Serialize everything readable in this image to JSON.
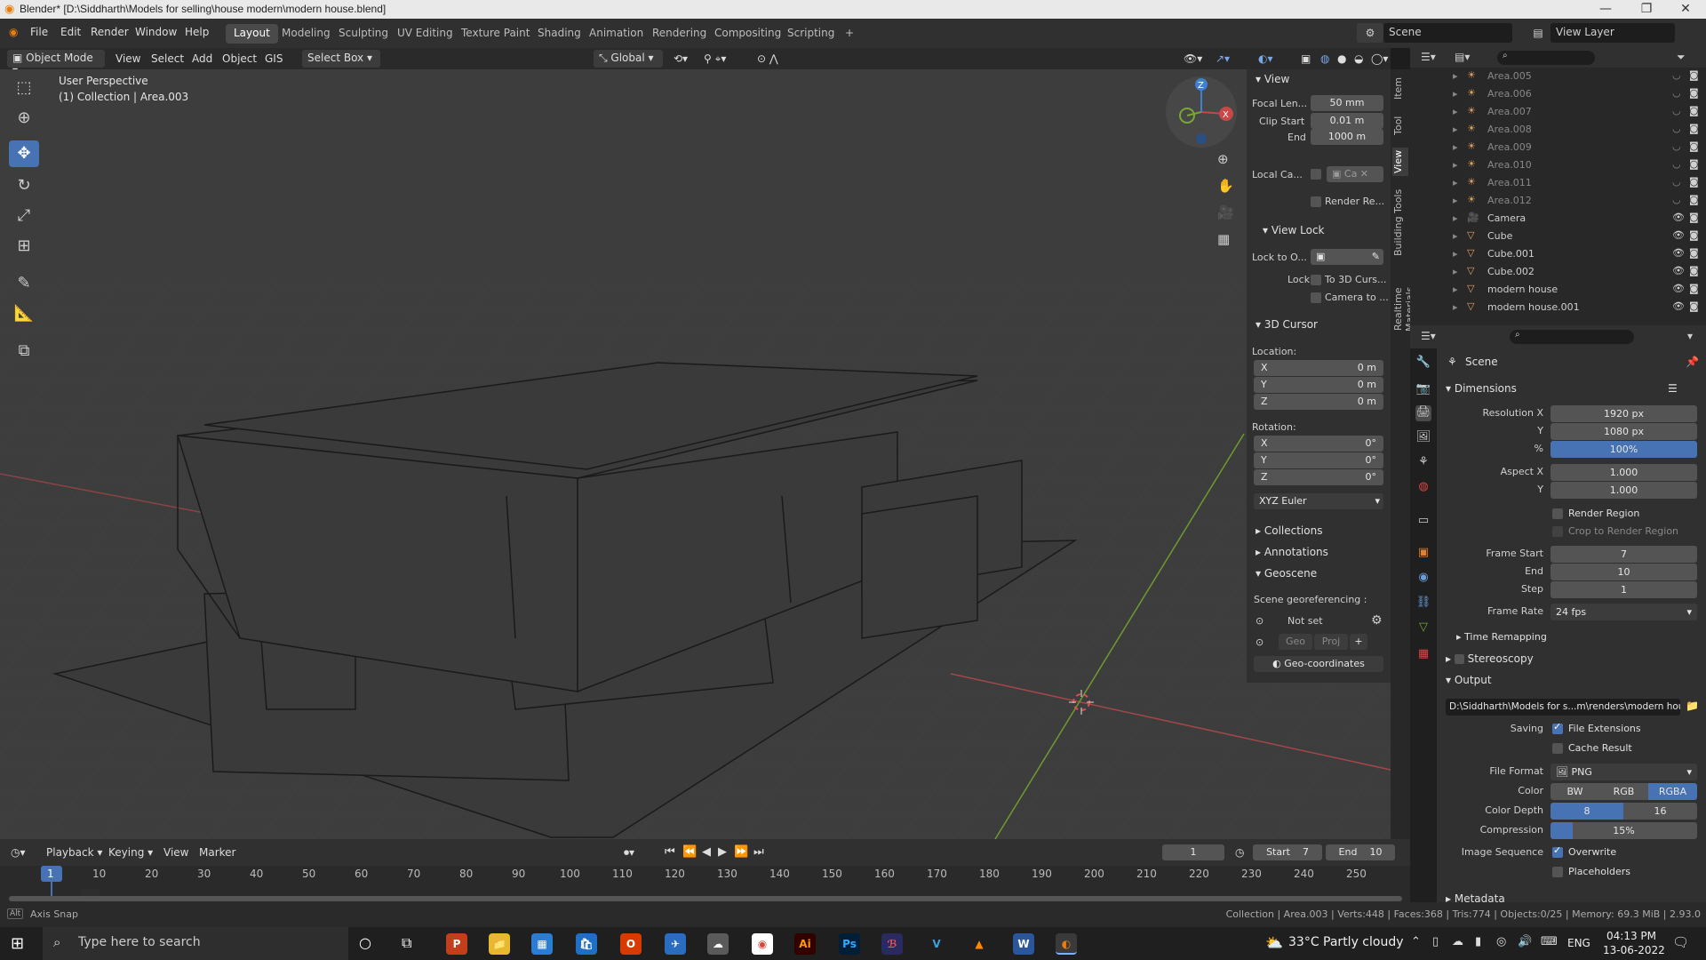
{
  "titlebar": {
    "title": "Blender* [D:\\Siddharth\\Models for selling\\house modern\\modern house.blend]",
    "minimize": "—",
    "maximize": "❐",
    "close": "✕"
  },
  "menu": {
    "items": [
      "File",
      "Edit",
      "Render",
      "Window",
      "Help"
    ],
    "workspaces": [
      "Layout",
      "Modeling",
      "Sculpting",
      "UV Editing",
      "Texture Paint",
      "Shading",
      "Animation",
      "Rendering",
      "Compositing",
      "Scripting"
    ],
    "active_workspace": "Layout",
    "add_workspace": "+",
    "scene": "Scene",
    "view_layer": "View Layer"
  },
  "viewport_header": {
    "mode": "Object Mode",
    "view": "View",
    "select": "Select",
    "add": "Add",
    "object": "Object",
    "gis": "GIS",
    "select_box": "Select Box",
    "orientation": "Global"
  },
  "viewport": {
    "perspective": "User Perspective",
    "collection": "(1) Collection | Area.003",
    "gizmo": {
      "x": "X",
      "y": "Y",
      "z": "Z"
    }
  },
  "npanel": {
    "tabs": [
      "Item",
      "Tool",
      "View",
      "Building Tools",
      "Realtime Materials"
    ],
    "view_section": "View",
    "focal_length_label": "Focal Len...",
    "focal_length": "50 mm",
    "clip_start_label": "Clip Start",
    "clip_start": "0.01 m",
    "end_label": "End",
    "end": "1000 m",
    "local_camera_label": "Local Ca...",
    "local_camera_value": "Ca",
    "render_region": "Render Re...",
    "view_lock_section": "View Lock",
    "lock_to_object_label": "Lock to O...",
    "lock_label": "Lock",
    "to_3d_cursor": "To 3D Curs...",
    "camera_to_view": "Camera to ...",
    "cursor_section": "3D Cursor",
    "location_label": "Location:",
    "loc_x": "0 m",
    "loc_y": "0 m",
    "loc_z": "0 m",
    "rotation_label": "Rotation:",
    "rot_x": "0°",
    "rot_y": "0°",
    "rot_z": "0°",
    "rotation_mode": "XYZ Euler",
    "collections": "Collections",
    "annotations": "Annotations",
    "geoscene": "Geoscene",
    "georef_label": "Scene georeferencing :",
    "not_set": "Not set",
    "geo": "Geo",
    "proj": "Proj",
    "geo_coordinates": "Geo-coordinates",
    "axis_x": "X",
    "axis_y": "Y",
    "axis_z": "Z"
  },
  "outliner": {
    "rows": [
      {
        "name": "Area.005",
        "visible": false
      },
      {
        "name": "Area.006",
        "visible": false
      },
      {
        "name": "Area.007",
        "visible": false
      },
      {
        "name": "Area.008",
        "visible": false
      },
      {
        "name": "Area.009",
        "visible": false
      },
      {
        "name": "Area.010",
        "visible": false
      },
      {
        "name": "Area.011",
        "visible": false
      },
      {
        "name": "Area.012",
        "visible": false
      },
      {
        "name": "Camera",
        "visible": true
      },
      {
        "name": "Cube",
        "visible": true
      },
      {
        "name": "Cube.001",
        "visible": true
      },
      {
        "name": "Cube.002",
        "visible": true
      },
      {
        "name": "modern house",
        "visible": true
      },
      {
        "name": "modern house.001",
        "visible": true
      }
    ]
  },
  "properties": {
    "scene": "Scene",
    "dimensions": "Dimensions",
    "resolution_x_label": "Resolution X",
    "resolution_x": "1920 px",
    "y_label": "Y",
    "resolution_y": "1080 px",
    "percent_label": "%",
    "percent": "100%",
    "aspect_x_label": "Aspect X",
    "aspect_x": "1.000",
    "aspect_y": "1.000",
    "render_region": "Render Region",
    "crop_to_render_region": "Crop to Render Region",
    "frame_start_label": "Frame Start",
    "frame_start": "7",
    "end_label": "End",
    "frame_end": "10",
    "step_label": "Step",
    "step": "1",
    "frame_rate_label": "Frame Rate",
    "frame_rate": "24 fps",
    "time_remapping": "Time Remapping",
    "stereoscopy": "Stereoscopy",
    "output": "Output",
    "output_path": "D:\\Siddharth\\Models for s...m\\renders\\modern house",
    "saving_label": "Saving",
    "file_extensions": "File Extensions",
    "cache_result": "Cache Result",
    "file_format_label": "File Format",
    "file_format": "PNG",
    "color_label": "Color",
    "color_bw": "BW",
    "color_rgb": "RGB",
    "color_rgba": "RGBA",
    "color_depth_label": "Color Depth",
    "depth_8": "8",
    "depth_16": "16",
    "compression_label": "Compression",
    "compression": "15%",
    "compression_fraction": 0.15,
    "image_sequence_label": "Image Sequence",
    "overwrite": "Overwrite",
    "placeholders": "Placeholders",
    "metadata": "Metadata"
  },
  "timeline": {
    "playback": "Playback",
    "keying": "Keying",
    "view": "View",
    "marker": "Marker",
    "current_frame": "1",
    "start_label": "Start",
    "start": "7",
    "end_label": "End",
    "end": "10",
    "ticks": [
      "1",
      "10",
      "20",
      "30",
      "40",
      "50",
      "60",
      "70",
      "80",
      "90",
      "100",
      "110",
      "120",
      "130",
      "140",
      "150",
      "160",
      "170",
      "180",
      "190",
      "200",
      "210",
      "220",
      "230",
      "240",
      "250"
    ]
  },
  "statusbar": {
    "hint_key": "Alt",
    "hint": "Axis Snap",
    "stats": "Collection | Area.003 | Verts:448 | Faces:368 | Tris:774 | Objects:0/25 | Memory: 69.3 MiB | 2.93.0"
  },
  "taskbar": {
    "search_placeholder": "Type here to search",
    "weather": "33°C  Partly cloudy",
    "lang": "ENG",
    "time": "04:13 PM",
    "date": "13-06-2022",
    "apps": [
      "P",
      "📁",
      "▦",
      "🛍",
      "O",
      "✈",
      "☁",
      "◉",
      "Ai",
      "Ps",
      "ℬ",
      "V",
      "▲",
      "W",
      "◐"
    ]
  },
  "colors": {
    "accent": "#4772b3",
    "viewport_bg": "#3d3d3d",
    "panel_bg": "#303030",
    "x_axis": "#c64848",
    "y_axis": "#7aa634",
    "z_axis": "#3f7fd5"
  }
}
